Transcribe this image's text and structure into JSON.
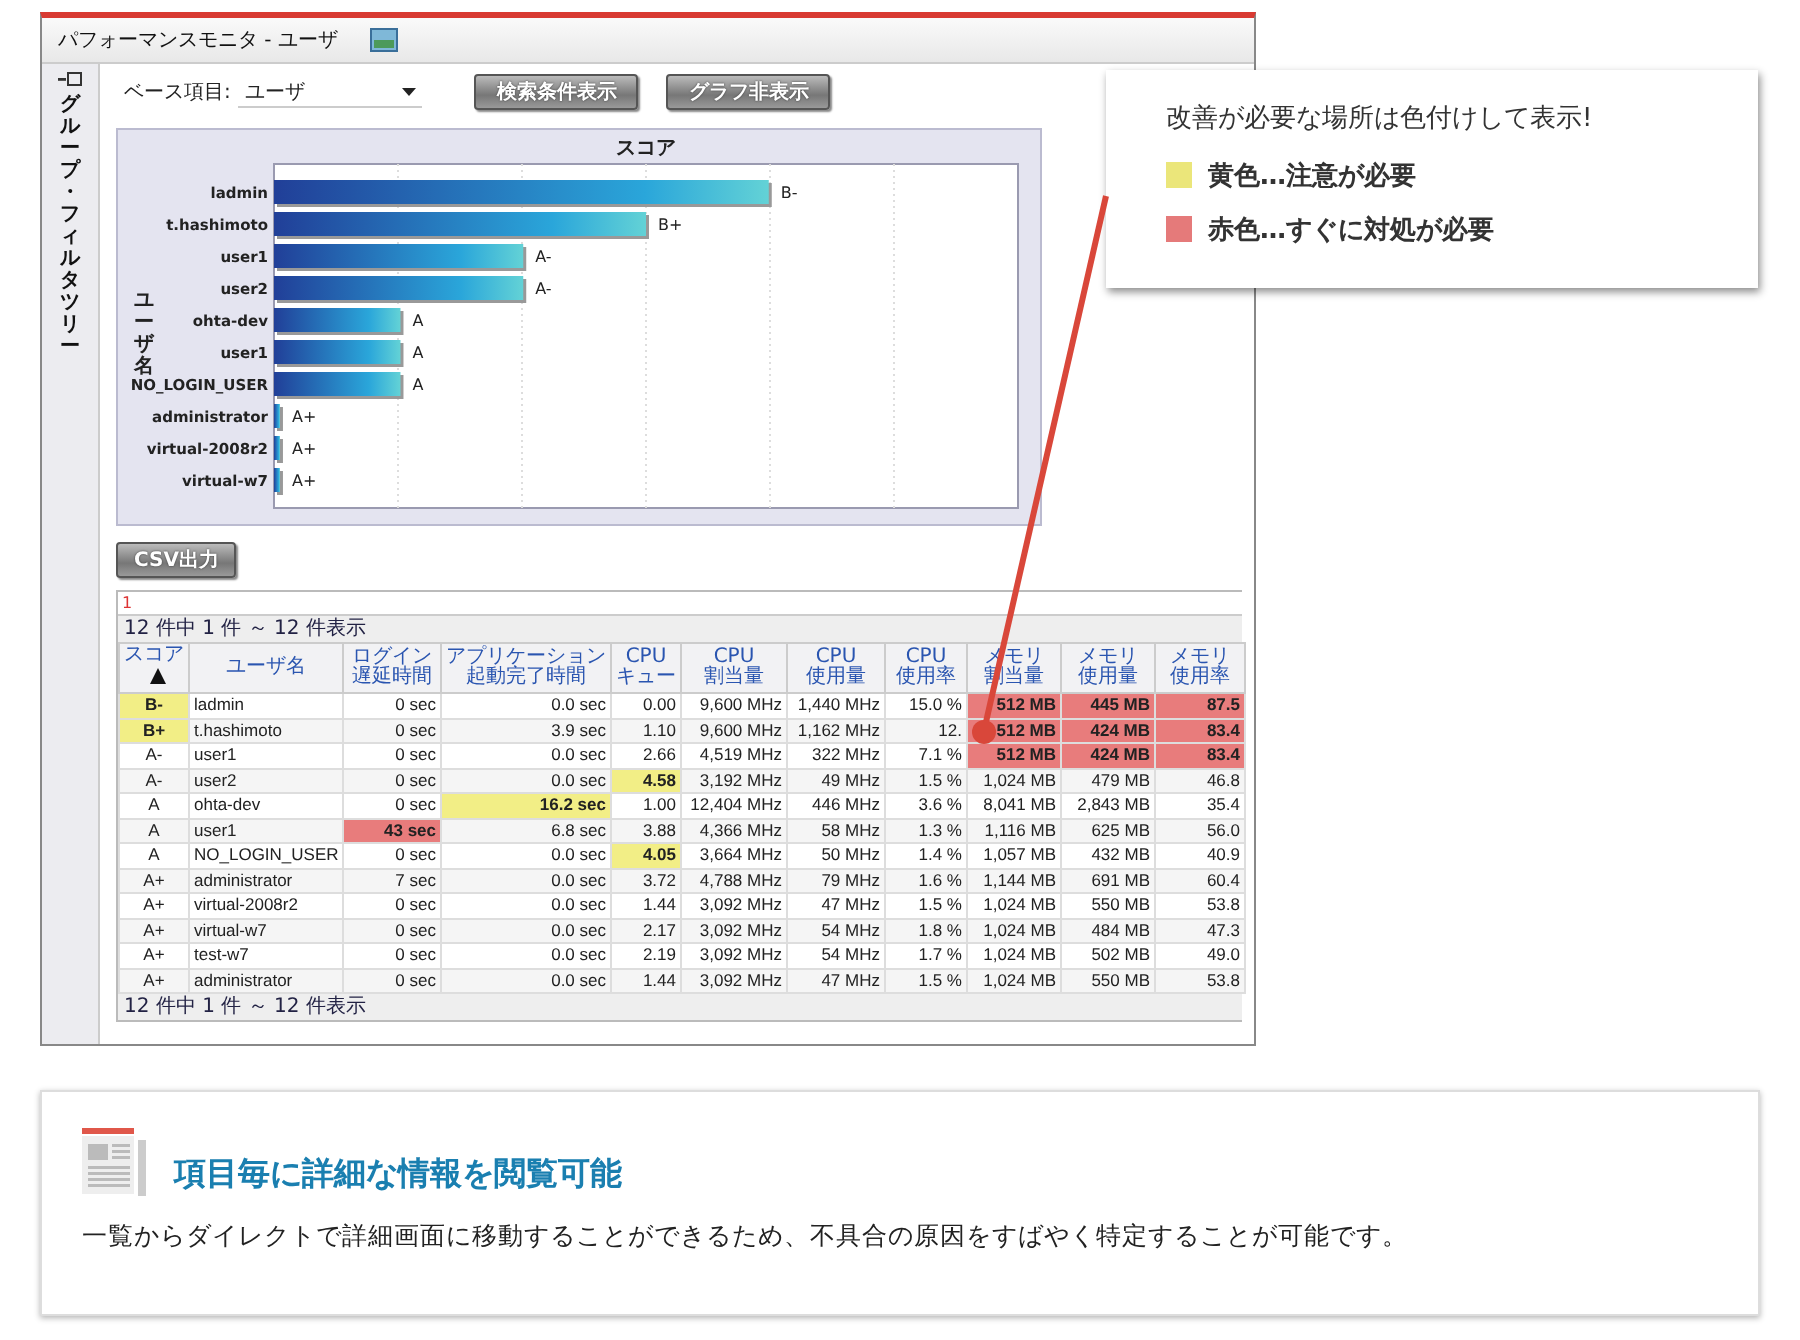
{
  "window": {
    "title": "パフォーマンスモニタ - ユーザ"
  },
  "sidebar": {
    "label": "グループ・フィルタツリー"
  },
  "toolbar": {
    "base_label": "ベース項目:",
    "base_value": "ユーザ",
    "buttons": [
      "検索条件表示",
      "グラフ非表示"
    ]
  },
  "chart": {
    "title": "スコア",
    "ylabel": "ユーザ名",
    "bars": [
      {
        "label": "ladmin",
        "grade": "B-"
      },
      {
        "label": "t.hashimoto",
        "grade": "B+"
      },
      {
        "label": "user1",
        "grade": "A-"
      },
      {
        "label": "user2",
        "grade": "A-"
      },
      {
        "label": "ohta-dev",
        "grade": "A"
      },
      {
        "label": "user1",
        "grade": "A"
      },
      {
        "label": "NO_LOGIN_USER",
        "grade": "A"
      },
      {
        "label": "administrator",
        "grade": "A+"
      },
      {
        "label": "virtual-2008r2",
        "grade": "A+"
      },
      {
        "label": "virtual-w7",
        "grade": "A+"
      }
    ]
  },
  "csv_button": "CSV出力",
  "table": {
    "page": "1",
    "summary_top": "12 件中 1 件 ～ 12 件表示",
    "columns": [
      {
        "label": "スコア",
        "sorted": true
      },
      {
        "label": "ユーザ名",
        "sorted": false
      },
      {
        "label": "ログイン遅延時間",
        "sorted": false
      },
      {
        "label": "アプリケーション起動完了時間",
        "sorted": false
      },
      {
        "label": "CPUキュー",
        "sorted": false
      },
      {
        "label": "CPU割当量",
        "sorted": false
      },
      {
        "label": "CPU使用量",
        "sorted": false
      },
      {
        "label": "CPU使用率",
        "sorted": false
      },
      {
        "label": "メモリ割当量",
        "sorted": false
      },
      {
        "label": "メモリ使用量",
        "sorted": false
      },
      {
        "label": "メモリ使用率",
        "sorted": false
      }
    ],
    "rows": [
      {
        "cells": [
          {
            "text": "B-",
            "color": "#f2ee86"
          },
          {
            "text": "ladmin"
          },
          {
            "text": "0 sec"
          },
          {
            "text": "0.0 sec"
          },
          {
            "text": "0.00"
          },
          {
            "text": "9,600 MHz"
          },
          {
            "text": "1,440 MHz"
          },
          {
            "text": "15.0 %"
          },
          {
            "text": "512 MB",
            "color": "#e87c7c"
          },
          {
            "text": "445 MB",
            "color": "#e87c7c"
          },
          {
            "text": "87.5",
            "color": "#e87c7c"
          }
        ]
      },
      {
        "cells": [
          {
            "text": "B+",
            "color": "#f2ee86"
          },
          {
            "text": "t.hashimoto"
          },
          {
            "text": "0 sec"
          },
          {
            "text": "3.9 sec"
          },
          {
            "text": "1.10"
          },
          {
            "text": "9,600 MHz"
          },
          {
            "text": "1,162 MHz"
          },
          {
            "text": "12."
          },
          {
            "text": "512 MB",
            "color": "#e87c7c"
          },
          {
            "text": "424 MB",
            "color": "#e87c7c"
          },
          {
            "text": "83.4",
            "color": "#e87c7c"
          }
        ]
      },
      {
        "cells": [
          {
            "text": "A-"
          },
          {
            "text": "user1"
          },
          {
            "text": "0 sec"
          },
          {
            "text": "0.0 sec"
          },
          {
            "text": "2.66"
          },
          {
            "text": "4,519 MHz"
          },
          {
            "text": "322 MHz"
          },
          {
            "text": "7.1 %"
          },
          {
            "text": "512 MB",
            "color": "#e87c7c"
          },
          {
            "text": "424 MB",
            "color": "#e87c7c"
          },
          {
            "text": "83.4",
            "color": "#e87c7c"
          }
        ]
      },
      {
        "cells": [
          {
            "text": "A-"
          },
          {
            "text": "user2"
          },
          {
            "text": "0 sec"
          },
          {
            "text": "0.0 sec"
          },
          {
            "text": "4.58",
            "color": "#f2ee86"
          },
          {
            "text": "3,192 MHz"
          },
          {
            "text": "49 MHz"
          },
          {
            "text": "1.5 %"
          },
          {
            "text": "1,024 MB"
          },
          {
            "text": "479 MB"
          },
          {
            "text": "46.8"
          }
        ]
      },
      {
        "cells": [
          {
            "text": "A"
          },
          {
            "text": "ohta-dev"
          },
          {
            "text": "0 sec"
          },
          {
            "text": "16.2 sec",
            "color": "#f2ee86"
          },
          {
            "text": "1.00"
          },
          {
            "text": "12,404 MHz"
          },
          {
            "text": "446 MHz"
          },
          {
            "text": "3.6 %"
          },
          {
            "text": "8,041 MB"
          },
          {
            "text": "2,843 MB"
          },
          {
            "text": "35.4"
          }
        ]
      },
      {
        "cells": [
          {
            "text": "A"
          },
          {
            "text": "user1"
          },
          {
            "text": "43 sec",
            "color": "#e87c7c"
          },
          {
            "text": "6.8 sec"
          },
          {
            "text": "3.88"
          },
          {
            "text": "4,366 MHz"
          },
          {
            "text": "58 MHz"
          },
          {
            "text": "1.3 %"
          },
          {
            "text": "1,116 MB"
          },
          {
            "text": "625 MB"
          },
          {
            "text": "56.0"
          }
        ]
      },
      {
        "cells": [
          {
            "text": "A"
          },
          {
            "text": "NO_LOGIN_USER"
          },
          {
            "text": "0 sec"
          },
          {
            "text": "0.0 sec"
          },
          {
            "text": "4.05",
            "color": "#f2ee86"
          },
          {
            "text": "3,664 MHz"
          },
          {
            "text": "50 MHz"
          },
          {
            "text": "1.4 %"
          },
          {
            "text": "1,057 MB"
          },
          {
            "text": "432 MB"
          },
          {
            "text": "40.9"
          }
        ]
      },
      {
        "cells": [
          {
            "text": "A+"
          },
          {
            "text": "administrator"
          },
          {
            "text": "7 sec"
          },
          {
            "text": "0.0 sec"
          },
          {
            "text": "3.72"
          },
          {
            "text": "4,788 MHz"
          },
          {
            "text": "79 MHz"
          },
          {
            "text": "1.6 %"
          },
          {
            "text": "1,144 MB"
          },
          {
            "text": "691 MB"
          },
          {
            "text": "60.4"
          }
        ]
      },
      {
        "cells": [
          {
            "text": "A+"
          },
          {
            "text": "virtual-2008r2"
          },
          {
            "text": "0 sec"
          },
          {
            "text": "0.0 sec"
          },
          {
            "text": "1.44"
          },
          {
            "text": "3,092 MHz"
          },
          {
            "text": "47 MHz"
          },
          {
            "text": "1.5 %"
          },
          {
            "text": "1,024 MB"
          },
          {
            "text": "550 MB"
          },
          {
            "text": "53.8"
          }
        ]
      },
      {
        "cells": [
          {
            "text": "A+"
          },
          {
            "text": "virtual-w7"
          },
          {
            "text": "0 sec"
          },
          {
            "text": "0.0 sec"
          },
          {
            "text": "2.17"
          },
          {
            "text": "3,092 MHz"
          },
          {
            "text": "54 MHz"
          },
          {
            "text": "1.8 %"
          },
          {
            "text": "1,024 MB"
          },
          {
            "text": "484 MB"
          },
          {
            "text": "47.3"
          }
        ]
      },
      {
        "cells": [
          {
            "text": "A+"
          },
          {
            "text": "test-w7"
          },
          {
            "text": "0 sec"
          },
          {
            "text": "0.0 sec"
          },
          {
            "text": "2.19"
          },
          {
            "text": "3,092 MHz"
          },
          {
            "text": "54 MHz"
          },
          {
            "text": "1.7 %"
          },
          {
            "text": "1,024 MB"
          },
          {
            "text": "502 MB"
          },
          {
            "text": "49.0"
          }
        ]
      },
      {
        "cells": [
          {
            "text": "A+"
          },
          {
            "text": "administrator"
          },
          {
            "text": "0 sec"
          },
          {
            "text": "0.0 sec"
          },
          {
            "text": "1.44"
          },
          {
            "text": "3,092 MHz"
          },
          {
            "text": "47 MHz"
          },
          {
            "text": "1.5 %"
          },
          {
            "text": "1,024 MB"
          },
          {
            "text": "550 MB"
          },
          {
            "text": "53.8"
          }
        ]
      }
    ],
    "summary_bottom": "12 件中 1 件 ～ 12 件表示"
  },
  "callout": {
    "title": "改善が必要な場所は色付けして表示!",
    "legend": [
      {
        "label": "黄色…注意が必要",
        "color": "#ebe67a"
      },
      {
        "label": "赤色…すぐに対処が必要",
        "color": "#e57a7a"
      }
    ]
  },
  "feature": {
    "heading": "項目毎に詳細な情報を閲覧可能",
    "text": "一覧からダイレクトで詳細画面に移動することができるため、不具合の原因をすばやく特定することが可能です。"
  }
}
